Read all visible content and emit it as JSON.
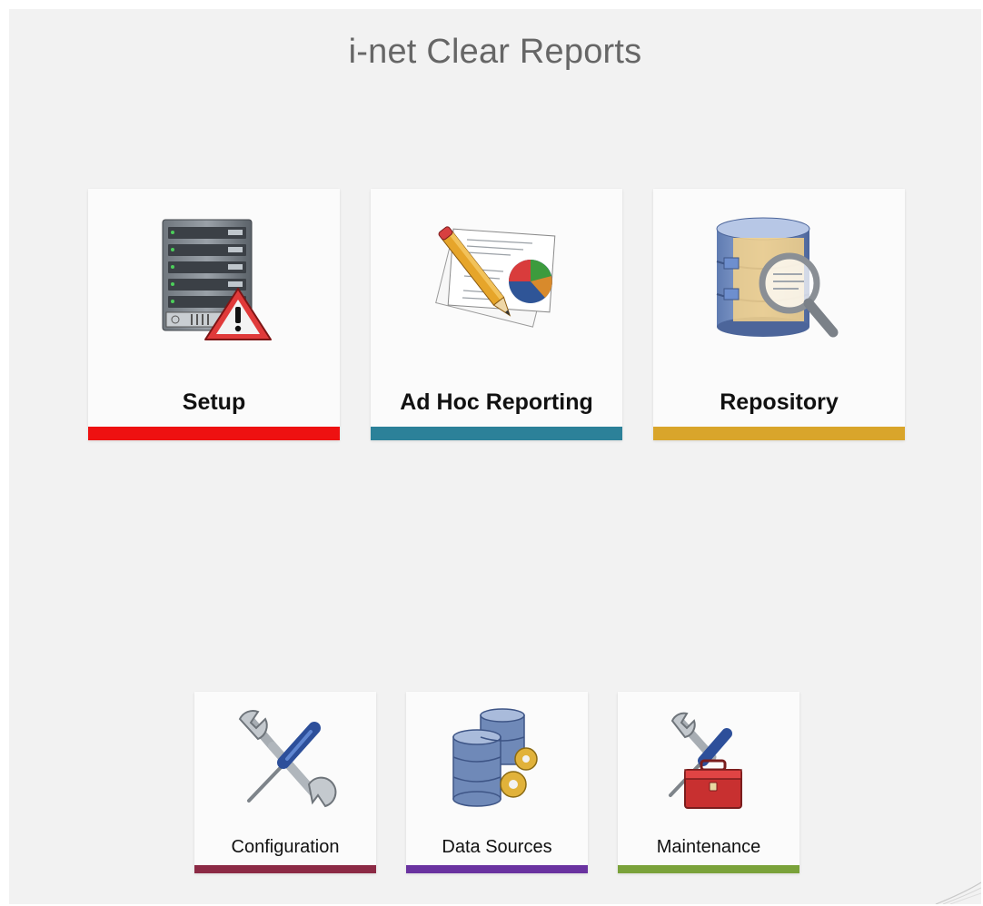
{
  "header": {
    "title": "i-net Clear Reports"
  },
  "main_tiles": [
    {
      "label": "Setup",
      "icon": "server-warning-icon",
      "accent": "#ee1111"
    },
    {
      "label": "Ad Hoc Reporting",
      "icon": "report-pencil-icon",
      "accent": "#2c8199"
    },
    {
      "label": "Repository",
      "icon": "database-search-icon",
      "accent": "#d9a52b"
    }
  ],
  "tool_tiles": [
    {
      "label": "Configuration",
      "icon": "wrench-screwdriver-icon",
      "accent": "#8c2a45"
    },
    {
      "label": "Data Sources",
      "icon": "database-gears-icon",
      "accent": "#6a33a0"
    },
    {
      "label": "Maintenance",
      "icon": "toolbox-icon",
      "accent": "#7aa23a"
    }
  ],
  "colors": {
    "background": "#f2f2f2",
    "tile": "#fbfbfb",
    "title_text": "#666666"
  }
}
